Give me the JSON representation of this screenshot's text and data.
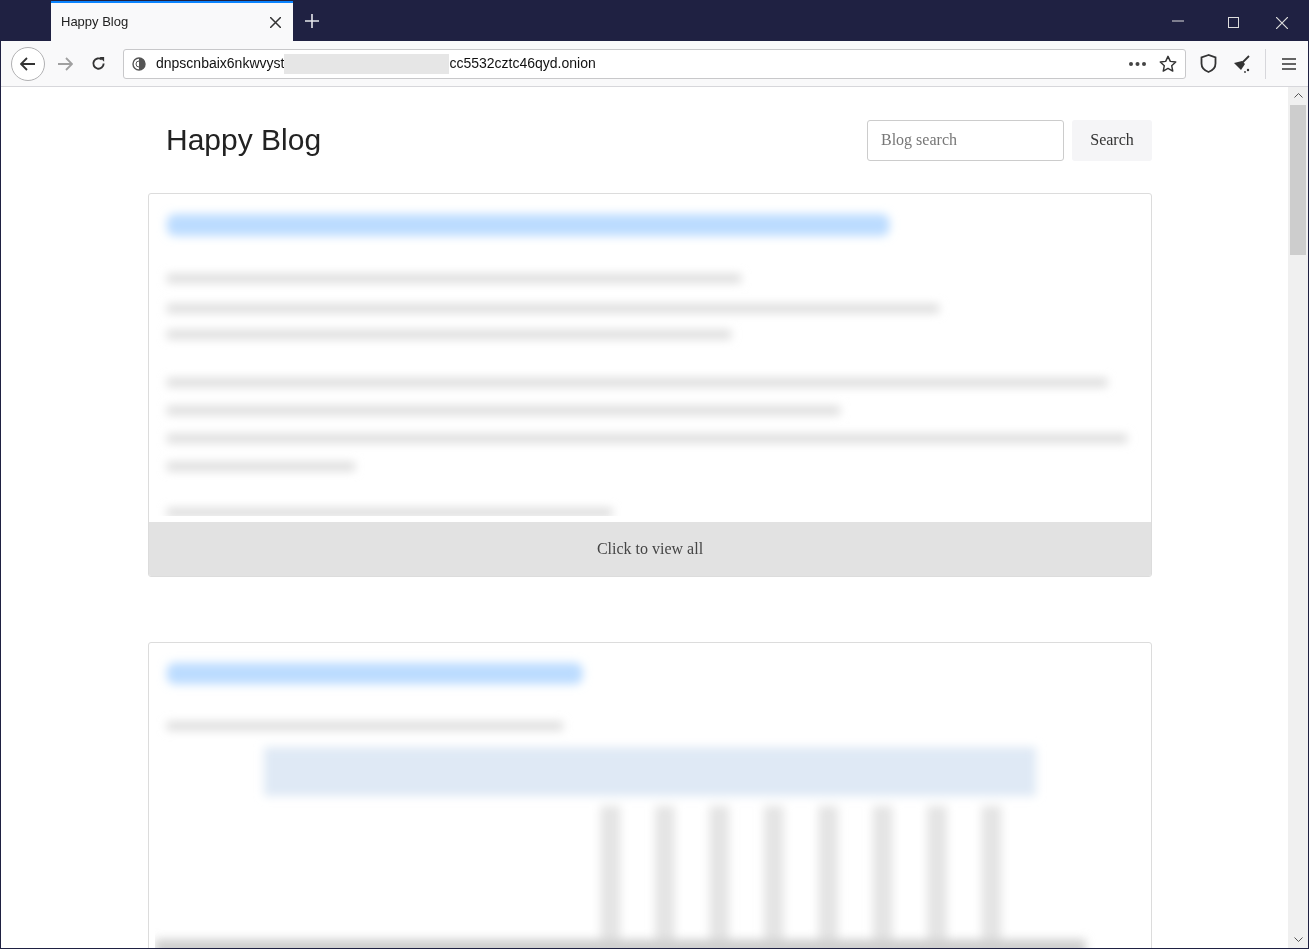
{
  "browser": {
    "tabs": [
      {
        "title": "Happy Blog",
        "selected": true
      }
    ],
    "url": {
      "start": "dnpscnbaix6nkwvyst",
      "end": "cc5532cztc46qyd.onion"
    }
  },
  "blog": {
    "title": "Happy Blog",
    "search": {
      "placeholder": "Blog search",
      "button": "Search"
    },
    "posts": [
      {
        "kind": "picture",
        "footer": "Click to view all"
      },
      {
        "kind": "picture"
      }
    ]
  }
}
